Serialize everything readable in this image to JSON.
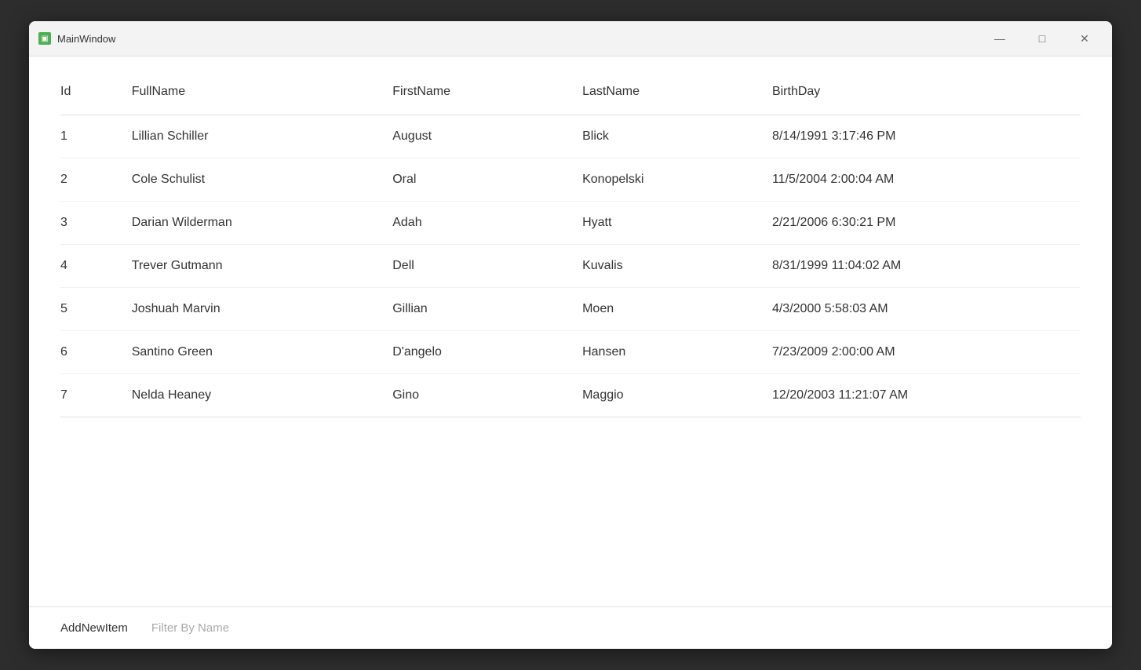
{
  "window": {
    "title": "MainWindow",
    "icon": "■"
  },
  "toolbar": {
    "buttons": [
      {
        "icon": "⊕",
        "name": "add-element",
        "active": false
      },
      {
        "icon": "▶",
        "name": "play",
        "active": false
      },
      {
        "icon": "↖",
        "name": "select",
        "active": false
      },
      {
        "icon": "□",
        "name": "rectangle",
        "active": false
      },
      {
        "icon": "⊞",
        "name": "grid",
        "active": false
      },
      {
        "icon": "⚙",
        "name": "settings",
        "active": false
      },
      {
        "icon": "♿",
        "name": "accessibility",
        "active": false
      },
      {
        "icon": "✓",
        "name": "check",
        "active": true,
        "green": true
      },
      {
        "icon": "‹",
        "name": "back",
        "active": false
      }
    ]
  },
  "table": {
    "headers": [
      {
        "key": "id",
        "label": "Id"
      },
      {
        "key": "fullname",
        "label": "FullName"
      },
      {
        "key": "firstname",
        "label": "FirstName"
      },
      {
        "key": "lastname",
        "label": "LastName"
      },
      {
        "key": "birthday",
        "label": "BirthDay"
      }
    ],
    "rows": [
      {
        "id": "1",
        "fullname": "Lillian Schiller",
        "firstname": "August",
        "lastname": "Blick",
        "birthday": "8/14/1991 3:17:46 PM"
      },
      {
        "id": "2",
        "fullname": "Cole Schulist",
        "firstname": "Oral",
        "lastname": "Konopelski",
        "birthday": "11/5/2004 2:00:04 AM"
      },
      {
        "id": "3",
        "fullname": "Darian Wilderman",
        "firstname": "Adah",
        "lastname": "Hyatt",
        "birthday": "2/21/2006 6:30:21 PM"
      },
      {
        "id": "4",
        "fullname": "Trever Gutmann",
        "firstname": "Dell",
        "lastname": "Kuvalis",
        "birthday": "8/31/1999 11:04:02 AM"
      },
      {
        "id": "5",
        "fullname": "Joshuah Marvin",
        "firstname": "Gillian",
        "lastname": "Moen",
        "birthday": "4/3/2000 5:58:03 AM"
      },
      {
        "id": "6",
        "fullname": "Santino Green",
        "firstname": "D'angelo",
        "lastname": "Hansen",
        "birthday": "7/23/2009 2:00:00 AM"
      },
      {
        "id": "7",
        "fullname": "Nelda Heaney",
        "firstname": "Gino",
        "lastname": "Maggio",
        "birthday": "12/20/2003 11:21:07 AM"
      }
    ]
  },
  "footer": {
    "add_button": "AddNewItem",
    "filter_button": "Filter By Name"
  },
  "titlebar": {
    "minimize": "—",
    "maximize": "□",
    "close": "✕"
  }
}
